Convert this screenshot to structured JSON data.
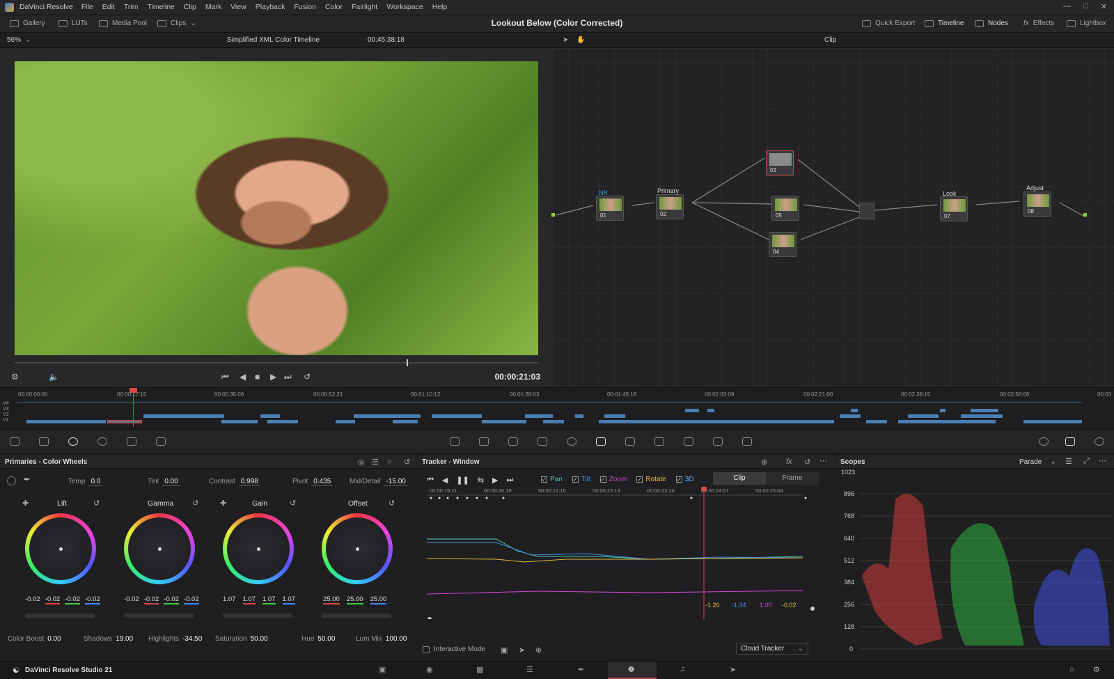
{
  "app": {
    "name": "DaVinci Resolve",
    "project_title": "Lookout Below (Color Corrected)",
    "status_name": "DaVinci Resolve Studio 21"
  },
  "menu": [
    "File",
    "Edit",
    "Trim",
    "Timeline",
    "Clip",
    "Mark",
    "View",
    "Playback",
    "Fusion",
    "Color",
    "Fairlight",
    "Workspace",
    "Help"
  ],
  "toolbar": {
    "left": [
      "Gallery",
      "LUTs",
      "Media Pool",
      "Clips"
    ],
    "right": [
      "Quick Export",
      "Timeline",
      "Nodes",
      "Effects",
      "Lightbox"
    ]
  },
  "viewer": {
    "zoom": "56%",
    "timeline_name": "Simplified XML Color Timeline",
    "source_tc": "00:45:38:18",
    "mode": "Clip",
    "timecode": "00:00:21:03"
  },
  "nodes": [
    {
      "label": "NR",
      "num": "01"
    },
    {
      "label": "Primary",
      "num": "02"
    },
    {
      "label": "",
      "num": "03"
    },
    {
      "label": "",
      "num": "05"
    },
    {
      "label": "",
      "num": "04"
    },
    {
      "label": "Look",
      "num": "07"
    },
    {
      "label": "Adjust",
      "num": "08"
    }
  ],
  "mini_timeline": {
    "ticks": [
      "00:00:00:00",
      "00:00:17:15",
      "00:00:35:06",
      "00:00:52:21",
      "00:01:10:12",
      "00:01:28:03",
      "00:01:45:18",
      "00:02:03:09",
      "00:02:21:00",
      "00:02:38:15",
      "00:02:56:06",
      "00:03"
    ],
    "tracks": [
      "V4",
      "V3",
      "V2",
      "V1"
    ]
  },
  "primaries": {
    "title": "Primaries - Color Wheels",
    "top_fields": [
      {
        "label": "Temp",
        "value": "0.0"
      },
      {
        "label": "Tint",
        "value": "0.00"
      },
      {
        "label": "Contrast",
        "value": "0.998"
      },
      {
        "label": "Pivot",
        "value": "0.435"
      },
      {
        "label": "Mid/Detail",
        "value": "-15.00"
      }
    ],
    "wheels": [
      {
        "name": "Lift",
        "values": [
          "-0.02",
          "-0.02",
          "-0.02",
          "-0.02"
        ]
      },
      {
        "name": "Gamma",
        "values": [
          "-0.02",
          "-0.02",
          "-0.02",
          "-0.02"
        ]
      },
      {
        "name": "Gain",
        "values": [
          "1.07",
          "1.07",
          "1.07",
          "1.07"
        ]
      },
      {
        "name": "Offset",
        "values": [
          "25.00",
          "25.00",
          "25.00"
        ]
      }
    ],
    "bottom_fields": [
      {
        "label": "Color Boost",
        "value": "0.00"
      },
      {
        "label": "Shadows",
        "value": "19.00"
      },
      {
        "label": "Highlights",
        "value": "-34.50"
      },
      {
        "label": "Saturation",
        "value": "50.00"
      },
      {
        "label": "Hue",
        "value": "50.00"
      },
      {
        "label": "Lum Mix",
        "value": "100.00"
      }
    ]
  },
  "tracker": {
    "title": "Tracker - Window",
    "checks": [
      "Pan",
      "Tilt",
      "Zoom",
      "Rotate",
      "3D"
    ],
    "tabs": [
      "Clip",
      "Frame"
    ],
    "ticks": [
      "00:00:19:21",
      "00:00:20:18",
      "00:00:21:15",
      "00:00:22:13",
      "00:00:23:10",
      "00:00:24:07",
      "00:00:25:04"
    ],
    "readouts": [
      "-1.20",
      "-1.34",
      "1.00",
      "-0.02"
    ],
    "interactive_mode": "Interactive Mode",
    "tracker_type": "Cloud Tracker"
  },
  "scopes": {
    "title": "Scopes",
    "mode": "Parade",
    "scale": [
      "1023",
      "896",
      "768",
      "640",
      "512",
      "384",
      "256",
      "128",
      "0"
    ]
  },
  "colors": {
    "accent_red": "#d04040",
    "node_green": "#8ad03a",
    "node_blue": "#2ea0e0",
    "clip_blue": "#4a7fb3"
  }
}
